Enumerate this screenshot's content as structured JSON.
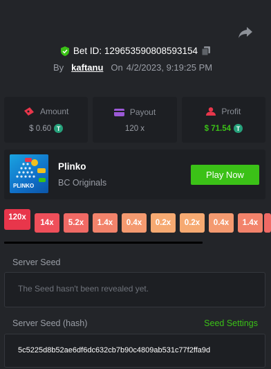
{
  "bet": {
    "id_text": "Bet ID: 129653590808593154",
    "by_label": "By",
    "username": "kaftanu",
    "on_label": "On",
    "datetime": "4/2/2023, 9:19:25 PM"
  },
  "stats": {
    "amount_label": "Amount",
    "amount_value": "$ 0.60",
    "payout_label": "Payout",
    "payout_value": "120 x",
    "profit_label": "Profit",
    "profit_value": "$ 71.54"
  },
  "game": {
    "name": "Plinko",
    "provider": "BC Originals",
    "thumb_text": "PLINKO",
    "play_label": "Play Now"
  },
  "multipliers": [
    {
      "label": "120x",
      "color": "#e8364b",
      "highlight": true
    },
    {
      "label": "14x",
      "color": "#ef4f5a",
      "highlight": false
    },
    {
      "label": "5.2x",
      "color": "#f06a65",
      "highlight": false
    },
    {
      "label": "1.4x",
      "color": "#f2836b",
      "highlight": false
    },
    {
      "label": "0.4x",
      "color": "#f49a70",
      "highlight": false
    },
    {
      "label": "0.2x",
      "color": "#f6aa72",
      "highlight": false
    },
    {
      "label": "0.2x",
      "color": "#f6aa72",
      "highlight": false
    },
    {
      "label": "0.4x",
      "color": "#f49a70",
      "highlight": false
    },
    {
      "label": "1.4x",
      "color": "#f2836b",
      "highlight": false
    },
    {
      "label": "",
      "color": "#f06a65",
      "highlight": false
    }
  ],
  "seeds": {
    "server_seed_label": "Server Seed",
    "server_seed_message": "The Seed hasn't been revealed yet.",
    "server_hash_label": "Server Seed (hash)",
    "seed_settings_label": "Seed Settings",
    "server_hash_value": "5c5225d8b52ae6df6dc632cb7b90c4809ab531c77f2ffa9d"
  },
  "colors": {
    "background": "#232529",
    "card": "#1d1f23",
    "accent_green": "#3bc117",
    "muted_text": "#9a9ea6"
  },
  "icons": {
    "share": "share-icon",
    "verified": "shield-check-icon",
    "copy": "copy-icon",
    "amount": "ticket-icon",
    "payout": "wallet-icon",
    "profit": "user-icon",
    "currency": "usdt-icon"
  }
}
